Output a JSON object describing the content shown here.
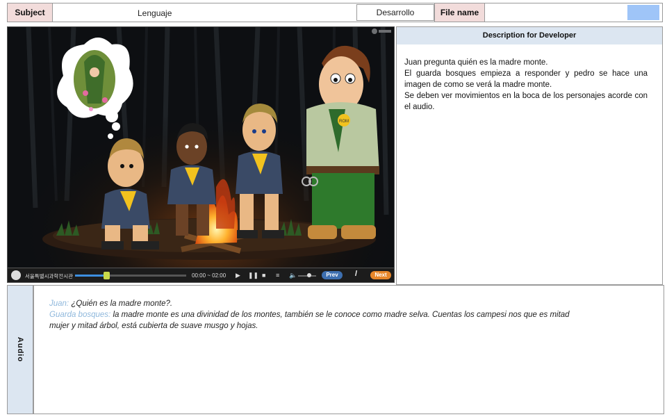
{
  "header": {
    "subject_label": "Subject",
    "subject_value": "Lenguaje",
    "stage_value": "Desarrollo",
    "file_name_label": "File name",
    "file_name_value": ""
  },
  "description": {
    "title": "Description for Developer",
    "lines": [
      "Juan pregunta quién es la madre monte.",
      "El guarda bosques empieza a responder y pedro se hace una imagen de como se verá la madre monte.",
      "Se deben ver movimientos en la boca de los personajes acorde con el audio."
    ]
  },
  "player": {
    "institution": "서울특별시과학전시관",
    "time": "00:00 ~ 02:00",
    "prev_label": "Prev",
    "separator": "/",
    "next_label": "Next",
    "progress_fraction": 0.28,
    "volume_fraction": 0.6,
    "scene_badge": "ROM"
  },
  "audio": {
    "label": "Audio",
    "line1_speaker": "Juan:",
    "line1_text": "¿Quién es la madre monte?.",
    "line2_speaker": "Guarda bosques:",
    "line2_text": "la madre monte es una divinidad de los montes, también se le conoce como madre selva. Cuentas los campesi nos que es mitad mujer y mitad árbol, está cubierta de suave musgo y hojas."
  },
  "colors": {
    "header_pink": "#f2dcdb",
    "panel_blue": "#dce6f1",
    "file_swatch": "#9fc5f8",
    "speaker_blue": "#8fb8dc"
  }
}
